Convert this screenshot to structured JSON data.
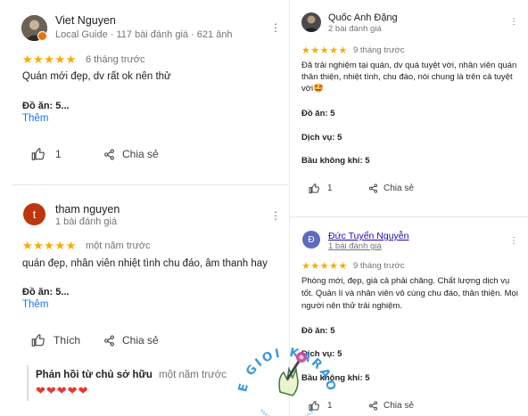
{
  "reviews_left": [
    {
      "name": "Viet Nguyen",
      "meta": "Local Guide · 117 bài đánh giá · 621 ảnh",
      "stars": "★★★★★",
      "time": "6 tháng trước",
      "text": "Quán mới đẹp, dv rất ok nên thử",
      "food": "Đồ ăn: 5...",
      "more": "Thêm",
      "like_count": "1",
      "share": "Chia sẻ"
    },
    {
      "avatar_letter": "t",
      "name": "tham nguyen",
      "meta": "1 bài đánh giá",
      "stars": "★★★★★",
      "time": "một năm trước",
      "text": "quán đẹp, nhân viên nhiệt tình chu đáo, âm thanh hay",
      "food": "Đồ ăn: 5...",
      "more": "Thêm",
      "like_label": "Thích",
      "share": "Chia sẻ",
      "owner_reply_label": "Phản hồi từ chủ sở hữu",
      "owner_reply_time": "một năm trước",
      "owner_reply_text": "❤❤❤❤❤"
    }
  ],
  "reviews_right": [
    {
      "name": "Quốc Anh Đặng",
      "meta": "2 bài đánh giá",
      "stars": "★★★★★",
      "time": "9 tháng trước",
      "text": "Đã trải nghiệm tại quán, dv quá tuyệt vời, nhân viên quán thân thiện, nhiệt tình, chu đáo, nói chung là trên cả tuyệt vời🤩",
      "food": "Đồ ăn: 5",
      "service": "Dịch vụ: 5",
      "atmosphere": "Bầu không khí: 5",
      "like_count": "1",
      "share": "Chia sẻ"
    },
    {
      "avatar_letter": "Đ",
      "name": "Đức Tuyển Nguyễn",
      "meta": "1 bài đánh giá",
      "stars": "★★★★★",
      "time": "9 tháng trước",
      "text": "Phòng mới, đẹp, giá cả phải chăng. Chất lượng dịch vụ tốt. Quản lí và nhân viên vô cùng chu đáo, thân thiện. Mọi người nên thử trải nghiệm.",
      "food": "Đồ ăn: 5",
      "service": "Dịch vụ: 5",
      "atmosphere": "Bầu không khí: 5",
      "like_count": "1",
      "share": "Chia sẻ"
    }
  ],
  "watermark": {
    "line1": "THE GIOI KARAOKE",
    "line2": "KARAOKE BOOKING SERVICE"
  },
  "colors": {
    "star": "#f9ab00",
    "link": "#1a73e8",
    "avatar_t": "#bf360c",
    "avatar_d": "#5c6bc0",
    "heart": "#e53935"
  }
}
